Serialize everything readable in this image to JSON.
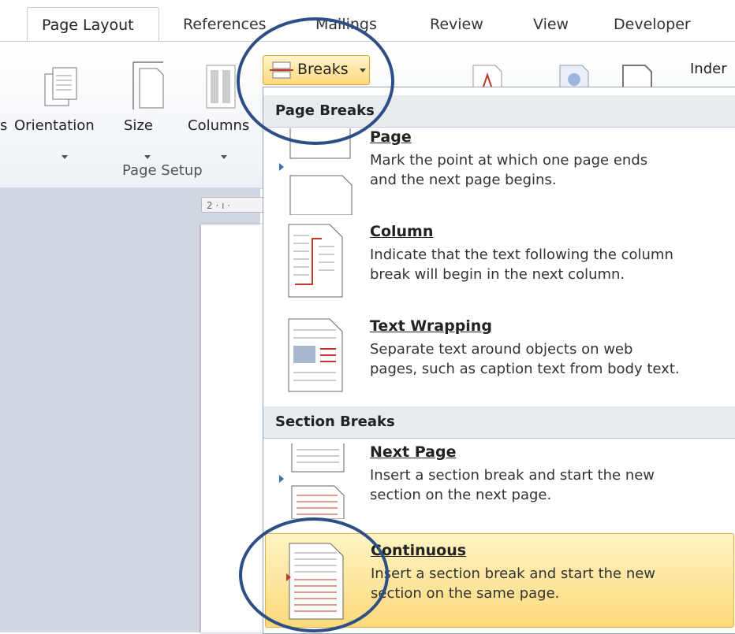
{
  "tabs": [
    {
      "label": "Page Layout",
      "active": true
    },
    {
      "label": "References"
    },
    {
      "label": "Mailings"
    },
    {
      "label": "Review"
    },
    {
      "label": "View"
    },
    {
      "label": "Developer"
    }
  ],
  "ribbon": {
    "orientation_label": "Orientation",
    "size_label": "Size",
    "columns_label": "Columns",
    "group_label": "Page Setup",
    "breaks_label": "Breaks",
    "indent_label": "Inder",
    "left_cut_label": "s"
  },
  "ruler": {
    "text": "2 · ı ·"
  },
  "menu": {
    "page_breaks_header": "Page Breaks",
    "section_breaks_header": "Section Breaks",
    "items": [
      {
        "title": "Page",
        "desc1": "Mark the point at which one page ends",
        "desc2": "and the next page begins.",
        "icon": "page-break-icon"
      },
      {
        "title": "Column",
        "desc1": "Indicate that the text following the column",
        "desc2": "break will begin in the next column.",
        "icon": "column-break-icon"
      },
      {
        "title": "Text Wrapping",
        "desc1": "Separate text around objects on web",
        "desc2": "pages, such as caption text from body text.",
        "icon": "text-wrapping-icon"
      },
      {
        "title": "Next Page",
        "desc1": "Insert a section break and start the new",
        "desc2": "section on the next page.",
        "icon": "next-page-icon"
      },
      {
        "title": "Continuous",
        "desc1": "Insert a section break and start the new",
        "desc2": "section on the same page.",
        "icon": "continuous-icon",
        "highlighted": true
      }
    ]
  },
  "colors": {
    "highlight": "#fcd97b",
    "annotation": "#2e4f86",
    "accent_red": "#c0392b"
  }
}
